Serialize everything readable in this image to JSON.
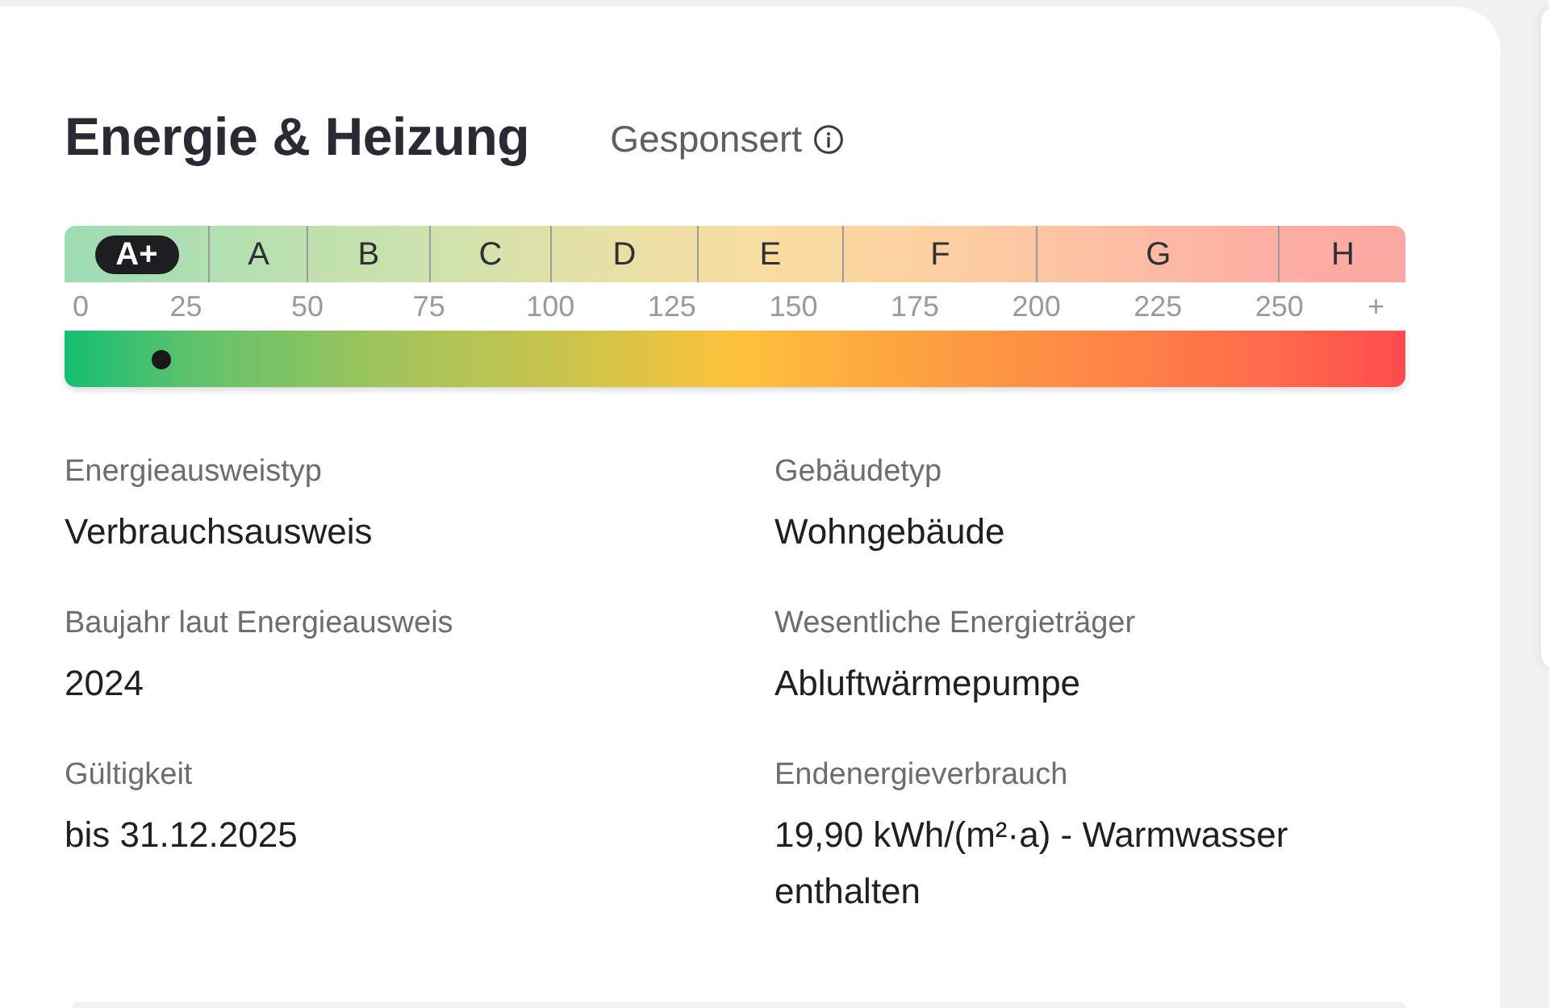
{
  "section": {
    "title": "Energie & Heizung",
    "sponsored_label": "Gesponsert"
  },
  "energy_scale": {
    "classes": [
      {
        "label": "A+",
        "selected": true
      },
      {
        "label": "A",
        "selected": false
      },
      {
        "label": "B",
        "selected": false
      },
      {
        "label": "C",
        "selected": false
      },
      {
        "label": "D",
        "selected": false
      },
      {
        "label": "E",
        "selected": false
      },
      {
        "label": "F",
        "selected": false
      },
      {
        "label": "G",
        "selected": false
      },
      {
        "label": "H",
        "selected": false
      }
    ],
    "ticks": [
      "0",
      "25",
      "50",
      "75",
      "100",
      "125",
      "150",
      "175",
      "200",
      "225",
      "250",
      "+"
    ],
    "level": 0.072
  },
  "details": [
    {
      "label": "Energieausweistyp",
      "value": "Verbrauchsausweis"
    },
    {
      "label": "Gebäudetyp",
      "value": "Wohngebäude"
    },
    {
      "label": "Baujahr laut Energieausweis",
      "value": "2024"
    },
    {
      "label": "Wesentliche Energieträger",
      "value": "Abluftwärmepumpe"
    },
    {
      "label": "Gültigkeit",
      "value": "bis 31.12.2025"
    },
    {
      "label": "Endenergieverbrauch",
      "value": "19,90 kWh/(m²·a) - Warmwasser enthalten"
    }
  ]
}
